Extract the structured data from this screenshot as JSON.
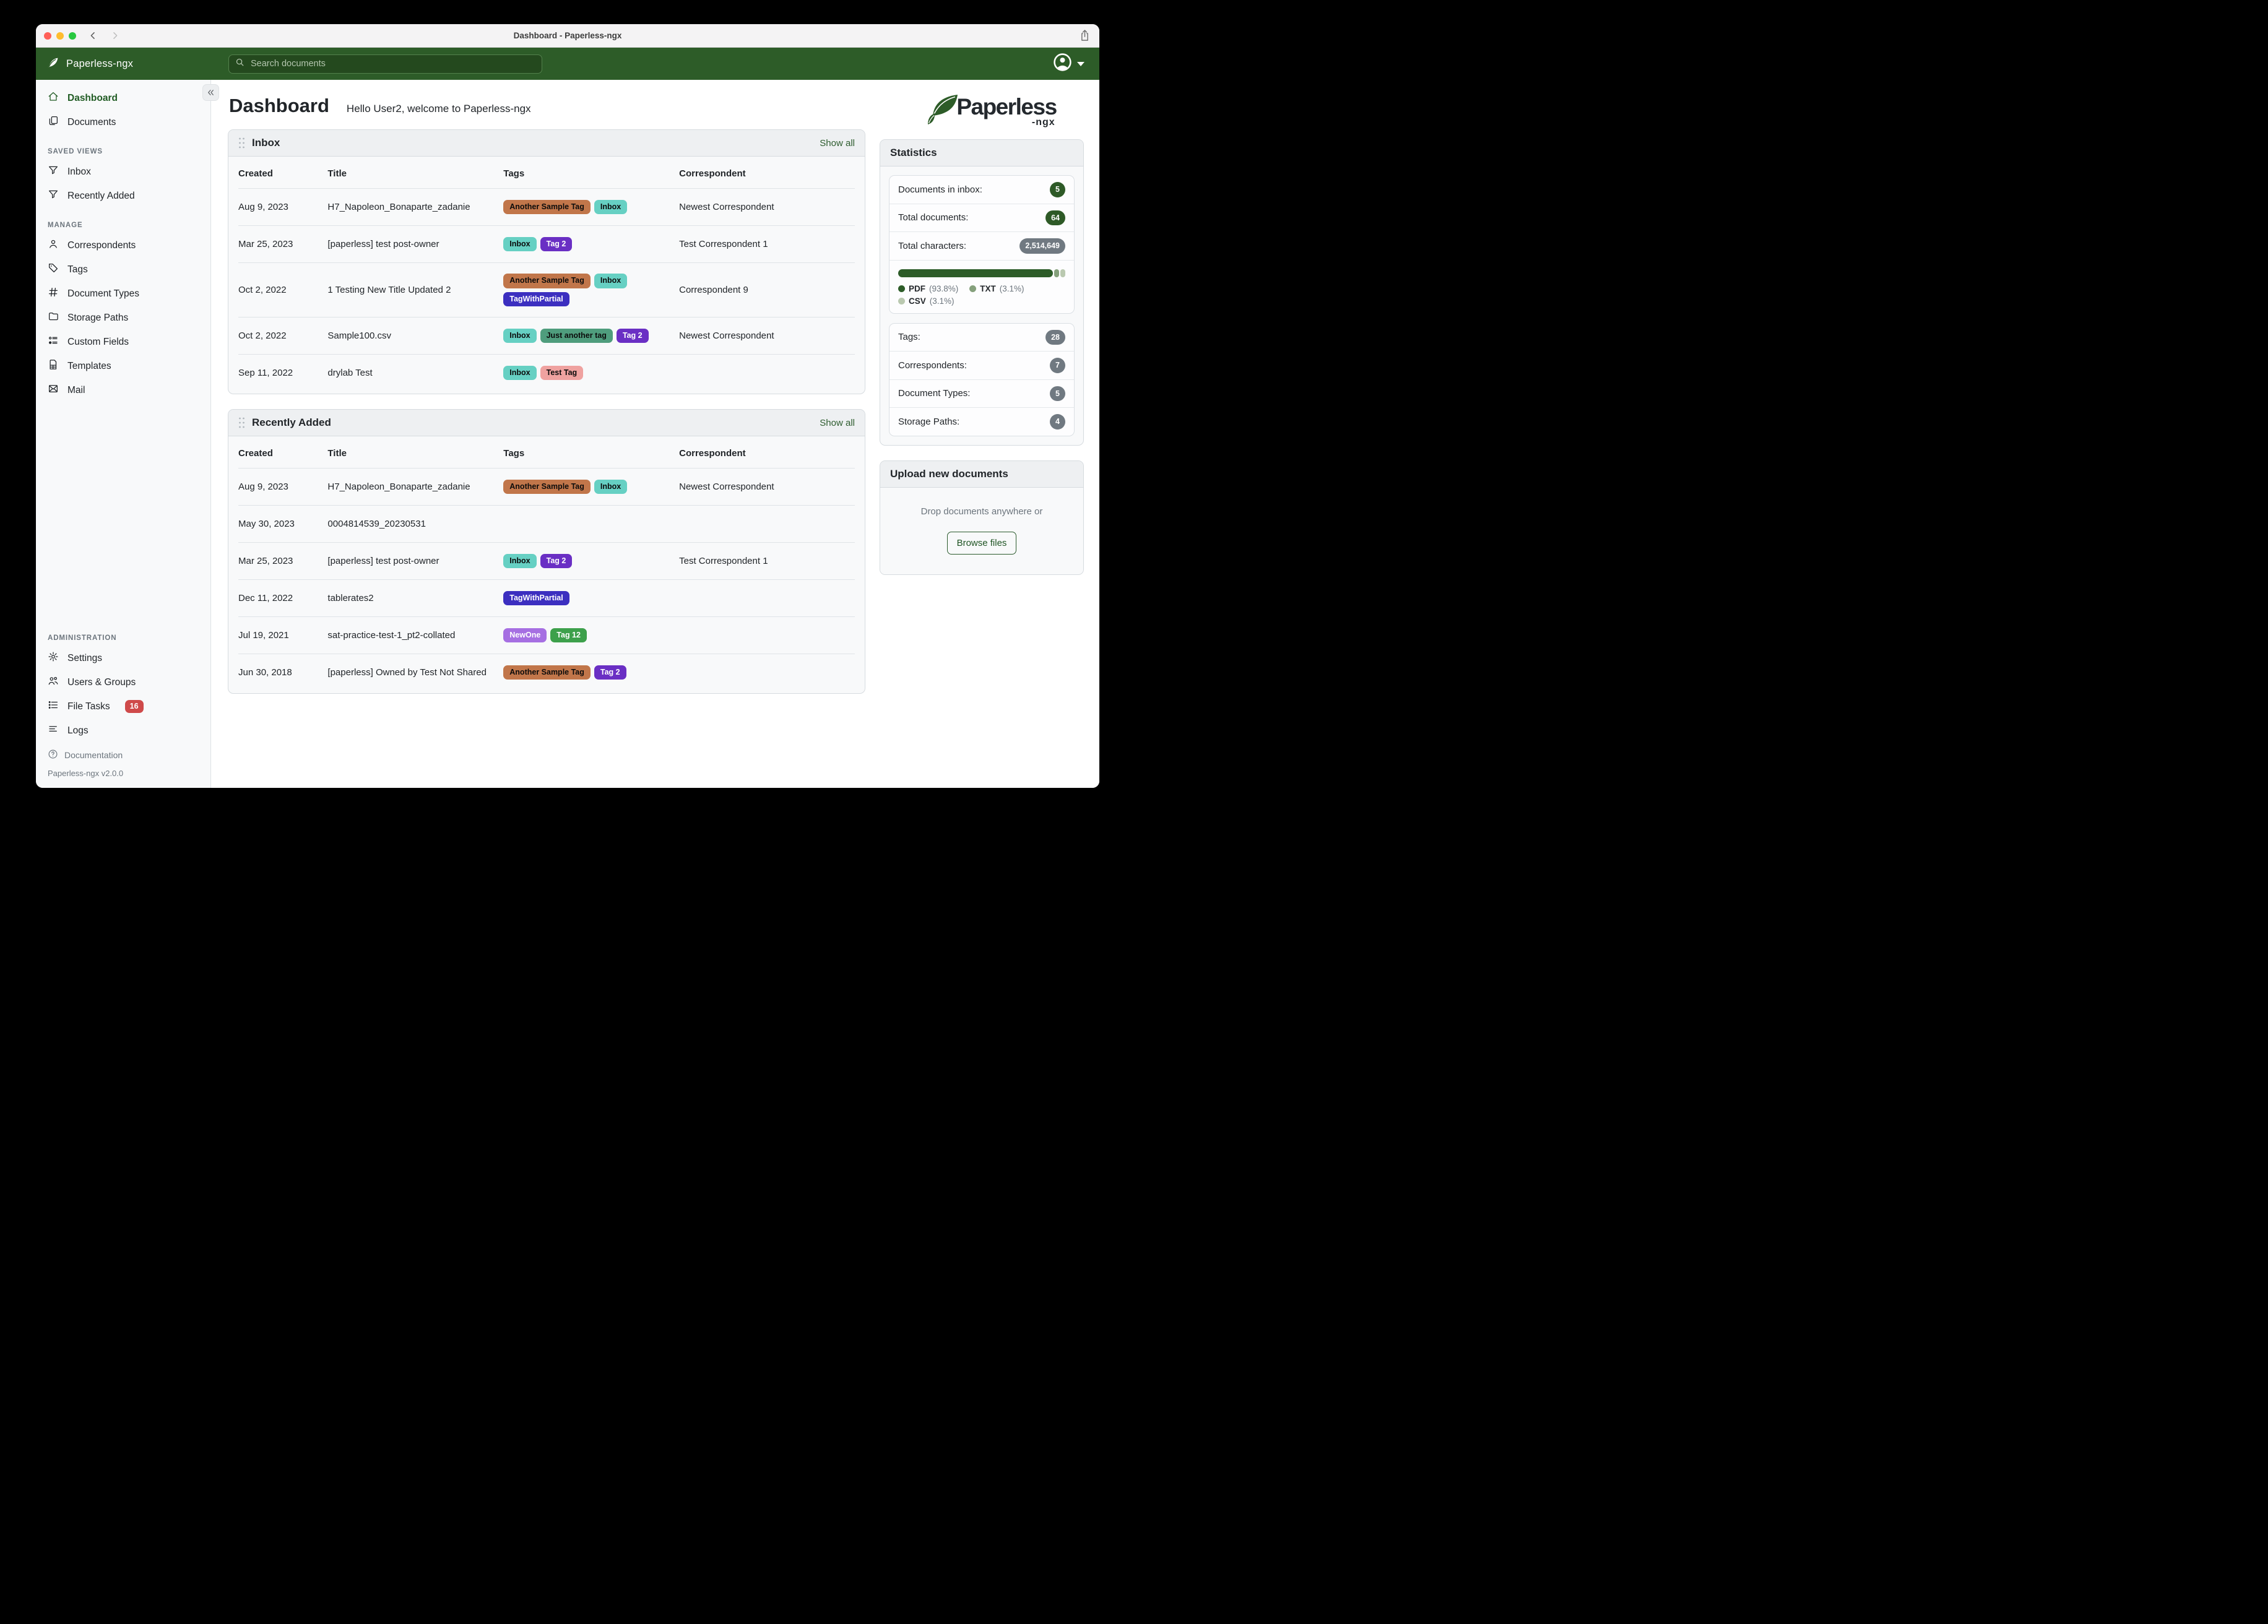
{
  "titlebar": {
    "title": "Dashboard - Paperless-ngx"
  },
  "navbar": {
    "brand": "Paperless-ngx",
    "search_placeholder": "Search documents"
  },
  "sidebar": {
    "dashboard": "Dashboard",
    "documents": "Documents",
    "saved_views_label": "SAVED VIEWS",
    "inbox": "Inbox",
    "recently_added": "Recently Added",
    "manage_label": "MANAGE",
    "correspondents": "Correspondents",
    "tags": "Tags",
    "document_types": "Document Types",
    "storage_paths": "Storage Paths",
    "custom_fields": "Custom Fields",
    "templates": "Templates",
    "mail": "Mail",
    "administration_label": "ADMINISTRATION",
    "settings": "Settings",
    "users_groups": "Users & Groups",
    "file_tasks": "File Tasks",
    "file_tasks_count": "16",
    "logs": "Logs",
    "documentation": "Documentation",
    "version": "Paperless-ngx v2.0.0"
  },
  "header": {
    "title": "Dashboard",
    "greeting": "Hello User2, welcome to Paperless-ngx"
  },
  "logo": {
    "word": "Paperless",
    "suffix": "-ngx"
  },
  "table_columns": [
    "Created",
    "Title",
    "Tags",
    "Correspondent"
  ],
  "tag_styles": {
    "Another Sample Tag": {
      "bg": "#c1764a",
      "fg": "#0b0b0b"
    },
    "Inbox": {
      "bg": "#66d0c3",
      "fg": "#0b0b0b"
    },
    "Tag 2": {
      "bg": "#6a2fc4",
      "fg": "#ffffff"
    },
    "TagWithPartial": {
      "bg": "#3c2fc0",
      "fg": "#ffffff"
    },
    "Just another tag": {
      "bg": "#4f9d7d",
      "fg": "#0b0b0b"
    },
    "Test Tag": {
      "bg": "#efa2a0",
      "fg": "#0b0b0b"
    },
    "NewOne": {
      "bg": "#a66fe2",
      "fg": "#ffffff"
    },
    "Tag 12": {
      "bg": "#3da04b",
      "fg": "#ffffff"
    }
  },
  "inbox_card": {
    "title": "Inbox",
    "show_all": "Show all",
    "rows": [
      {
        "created": "Aug 9, 2023",
        "title": "H7_Napoleon_Bonaparte_zadanie",
        "tags": [
          "Another Sample Tag",
          "Inbox"
        ],
        "correspondent": "Newest Correspondent"
      },
      {
        "created": "Mar 25, 2023",
        "title": "[paperless] test post-owner",
        "tags": [
          "Inbox",
          "Tag 2"
        ],
        "correspondent": "Test Correspondent 1"
      },
      {
        "created": "Oct 2, 2022",
        "title": "1 Testing New Title Updated 2",
        "tags": [
          "Another Sample Tag",
          "Inbox",
          "TagWithPartial"
        ],
        "correspondent": "Correspondent 9"
      },
      {
        "created": "Oct 2, 2022",
        "title": "Sample100.csv",
        "tags": [
          "Inbox",
          "Just another tag",
          "Tag 2"
        ],
        "correspondent": "Newest Correspondent"
      },
      {
        "created": "Sep 11, 2022",
        "title": "drylab Test",
        "tags": [
          "Inbox",
          "Test Tag"
        ],
        "correspondent": ""
      }
    ]
  },
  "recently_added_card": {
    "title": "Recently Added",
    "show_all": "Show all",
    "rows": [
      {
        "created": "Aug 9, 2023",
        "title": "H7_Napoleon_Bonaparte_zadanie",
        "tags": [
          "Another Sample Tag",
          "Inbox"
        ],
        "correspondent": "Newest Correspondent"
      },
      {
        "created": "May 30, 2023",
        "title": "0004814539_20230531",
        "tags": [],
        "correspondent": ""
      },
      {
        "created": "Mar 25, 2023",
        "title": "[paperless] test post-owner",
        "tags": [
          "Inbox",
          "Tag 2"
        ],
        "correspondent": "Test Correspondent 1"
      },
      {
        "created": "Dec 11, 2022",
        "title": "tablerates2",
        "tags": [
          "TagWithPartial"
        ],
        "correspondent": ""
      },
      {
        "created": "Jul 19, 2021",
        "title": "sat-practice-test-1_pt2-collated",
        "tags": [
          "NewOne",
          "Tag 12"
        ],
        "correspondent": ""
      },
      {
        "created": "Jun 30, 2018",
        "title": "[paperless] Owned by Test Not Shared",
        "tags": [
          "Another Sample Tag",
          "Tag 2"
        ],
        "correspondent": ""
      }
    ]
  },
  "statistics": {
    "title": "Statistics",
    "rows1": [
      {
        "label": "Documents in inbox:",
        "value": "5"
      },
      {
        "label": "Total documents:",
        "value": "64"
      },
      {
        "label": "Total characters:",
        "value": "2,514,649"
      }
    ],
    "file_types": [
      {
        "label": "PDF",
        "pct": 93.8,
        "pct_text": "(93.8%)",
        "color": "#2d5c28"
      },
      {
        "label": "TXT",
        "pct": 3.1,
        "pct_text": "(3.1%)",
        "color": "#85a07c"
      },
      {
        "label": "CSV",
        "pct": 3.1,
        "pct_text": "(3.1%)",
        "color": "#bac9b0"
      }
    ],
    "rows2": [
      {
        "label": "Tags:",
        "value": "28"
      },
      {
        "label": "Correspondents:",
        "value": "7"
      },
      {
        "label": "Document Types:",
        "value": "5"
      },
      {
        "label": "Storage Paths:",
        "value": "4"
      }
    ]
  },
  "upload_card": {
    "title": "Upload new documents",
    "hint": "Drop documents anywhere or",
    "button": "Browse files"
  },
  "colors": {
    "navbar_green": "#2d5c28",
    "link_green": "#2d5c2e",
    "active_nav_green": "#215c24",
    "badge_green": "#2e5a27",
    "badge_gray": "#707981",
    "file_tasks_badge_red": "#cf4a4a"
  }
}
